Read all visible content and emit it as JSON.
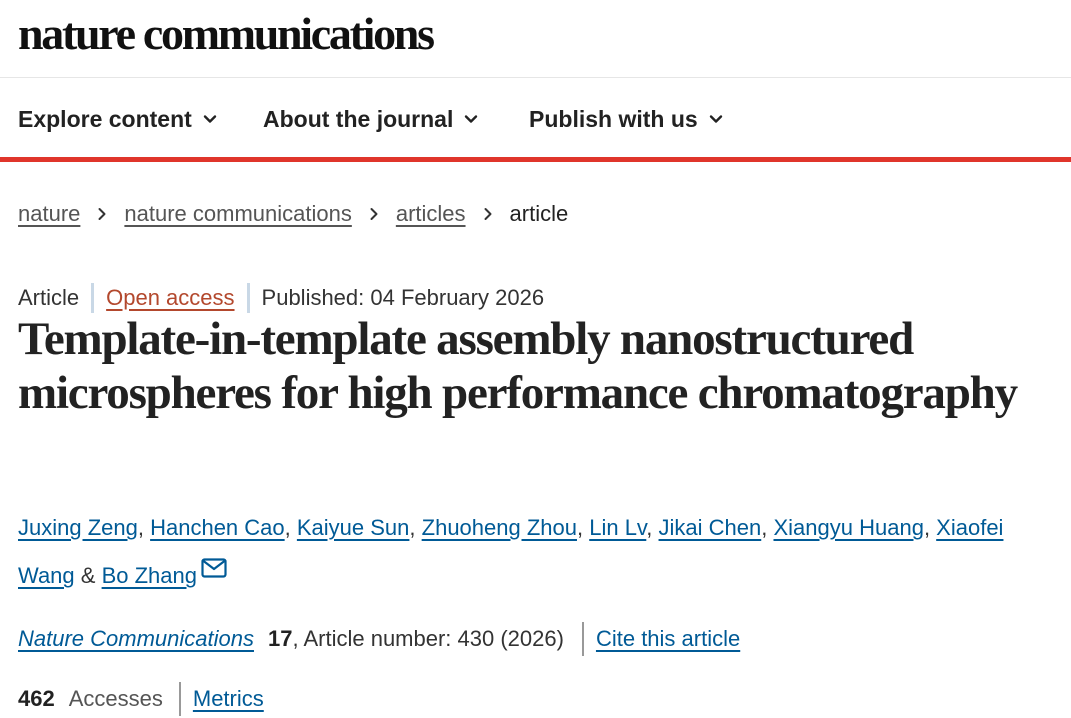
{
  "header": {
    "logo": "nature communications"
  },
  "nav": {
    "items": [
      {
        "label": "Explore content",
        "icon": "chevron-down-icon"
      },
      {
        "label": "About the journal",
        "icon": "chevron-down-icon"
      },
      {
        "label": "Publish with us",
        "icon": "chevron-down-icon"
      }
    ],
    "accent_color": "#e0352b"
  },
  "breadcrumb": {
    "items": [
      "nature",
      "nature communications",
      "articles"
    ],
    "current": "article"
  },
  "article": {
    "type": "Article",
    "access": "Open access",
    "published": "Published: 04 February 2026",
    "title": "Template-in-template assembly nanostructured microspheres for high performance chromatography",
    "authors": [
      "Juxing Zeng",
      "Hanchen Cao",
      "Kaiyue Sun",
      "Zhuoheng Zhou",
      "Lin Lv",
      "Jikai Chen",
      "Xiangyu Huang",
      "Xiaofei Wang",
      "Bo Zhang"
    ],
    "authors_and": "&",
    "journal": "Nature Communications",
    "volume": "17",
    "article_number": ", Article number: 430 (2026)",
    "cite_label": "Cite this article",
    "accesses_count": "462",
    "accesses_label": "Accesses",
    "metrics_label": "Metrics"
  },
  "colors": {
    "link": "#005a96",
    "open_access": "#b3482d",
    "text": "#222222"
  }
}
